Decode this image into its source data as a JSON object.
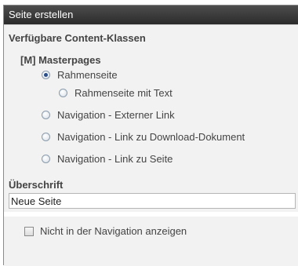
{
  "dialog": {
    "title": "Seite erstellen"
  },
  "content_classes": {
    "heading": "Verfügbare Content-Klassen",
    "group_label": "[M] Masterpages",
    "options": [
      {
        "label": "Rahmenseite",
        "selected": true
      },
      {
        "label": "Rahmenseite mit Text",
        "selected": false
      },
      {
        "label": "Navigation - Externer Link",
        "selected": false
      },
      {
        "label": "Navigation - Link zu Download-Dokument",
        "selected": false
      },
      {
        "label": "Navigation - Link zu Seite",
        "selected": false
      }
    ]
  },
  "headline": {
    "label": "Überschrift",
    "value": "Neue Seite"
  },
  "hide_in_navigation": {
    "label": "Nicht in der Navigation anzeigen",
    "checked": false
  }
}
